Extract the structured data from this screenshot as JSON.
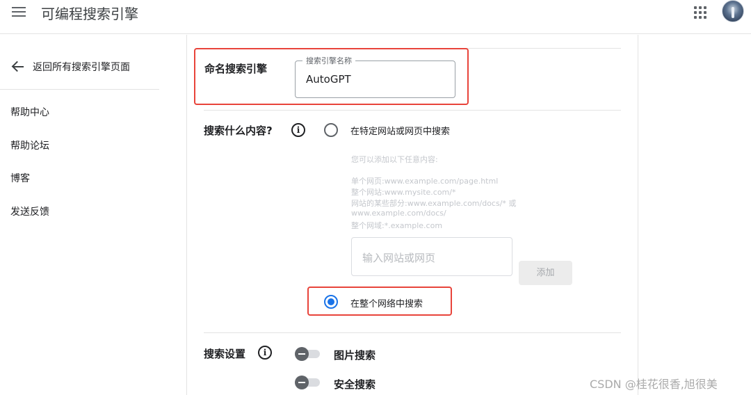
{
  "header": {
    "menu_icon": "menu-icon",
    "title": "可编程搜索引擎",
    "apps_icon": "apps-grid-icon",
    "avatar": "avatar"
  },
  "sidebar": {
    "back_label": "返回所有搜索引擎页面",
    "items": [
      {
        "label": "帮助中心"
      },
      {
        "label": "帮助论坛"
      },
      {
        "label": "博客"
      },
      {
        "label": "发送反馈"
      }
    ]
  },
  "name_section": {
    "label": "命名搜索引擎",
    "field_legend": "搜索引擎名称",
    "field_value": "AutoGPT"
  },
  "what_section": {
    "label": "搜索什么内容?",
    "info_icon": "info-icon",
    "option_specific": "在特定网站或网页中搜索",
    "hint_title": "您可以添加以下任意内容:",
    "hint_lines": [
      "单个网页:www.example.com/page.html",
      "整个网站:www.mysite.com/*",
      "网站的某些部分:www.example.com/docs/* 或",
      "www.example.com/docs/",
      "整个网域:*.example.com"
    ],
    "site_input_placeholder": "输入网站或网页",
    "add_button": "添加",
    "option_entire_web": "在整个网络中搜索",
    "selected": "entire_web"
  },
  "settings_section": {
    "label": "搜索设置",
    "toggles": [
      {
        "label": "图片搜索",
        "on": false
      },
      {
        "label": "安全搜索",
        "on": false
      }
    ]
  },
  "colors": {
    "highlight": "#e8433a",
    "accent": "#1a73e8"
  },
  "watermark": "CSDN @桂花很香,旭很美"
}
